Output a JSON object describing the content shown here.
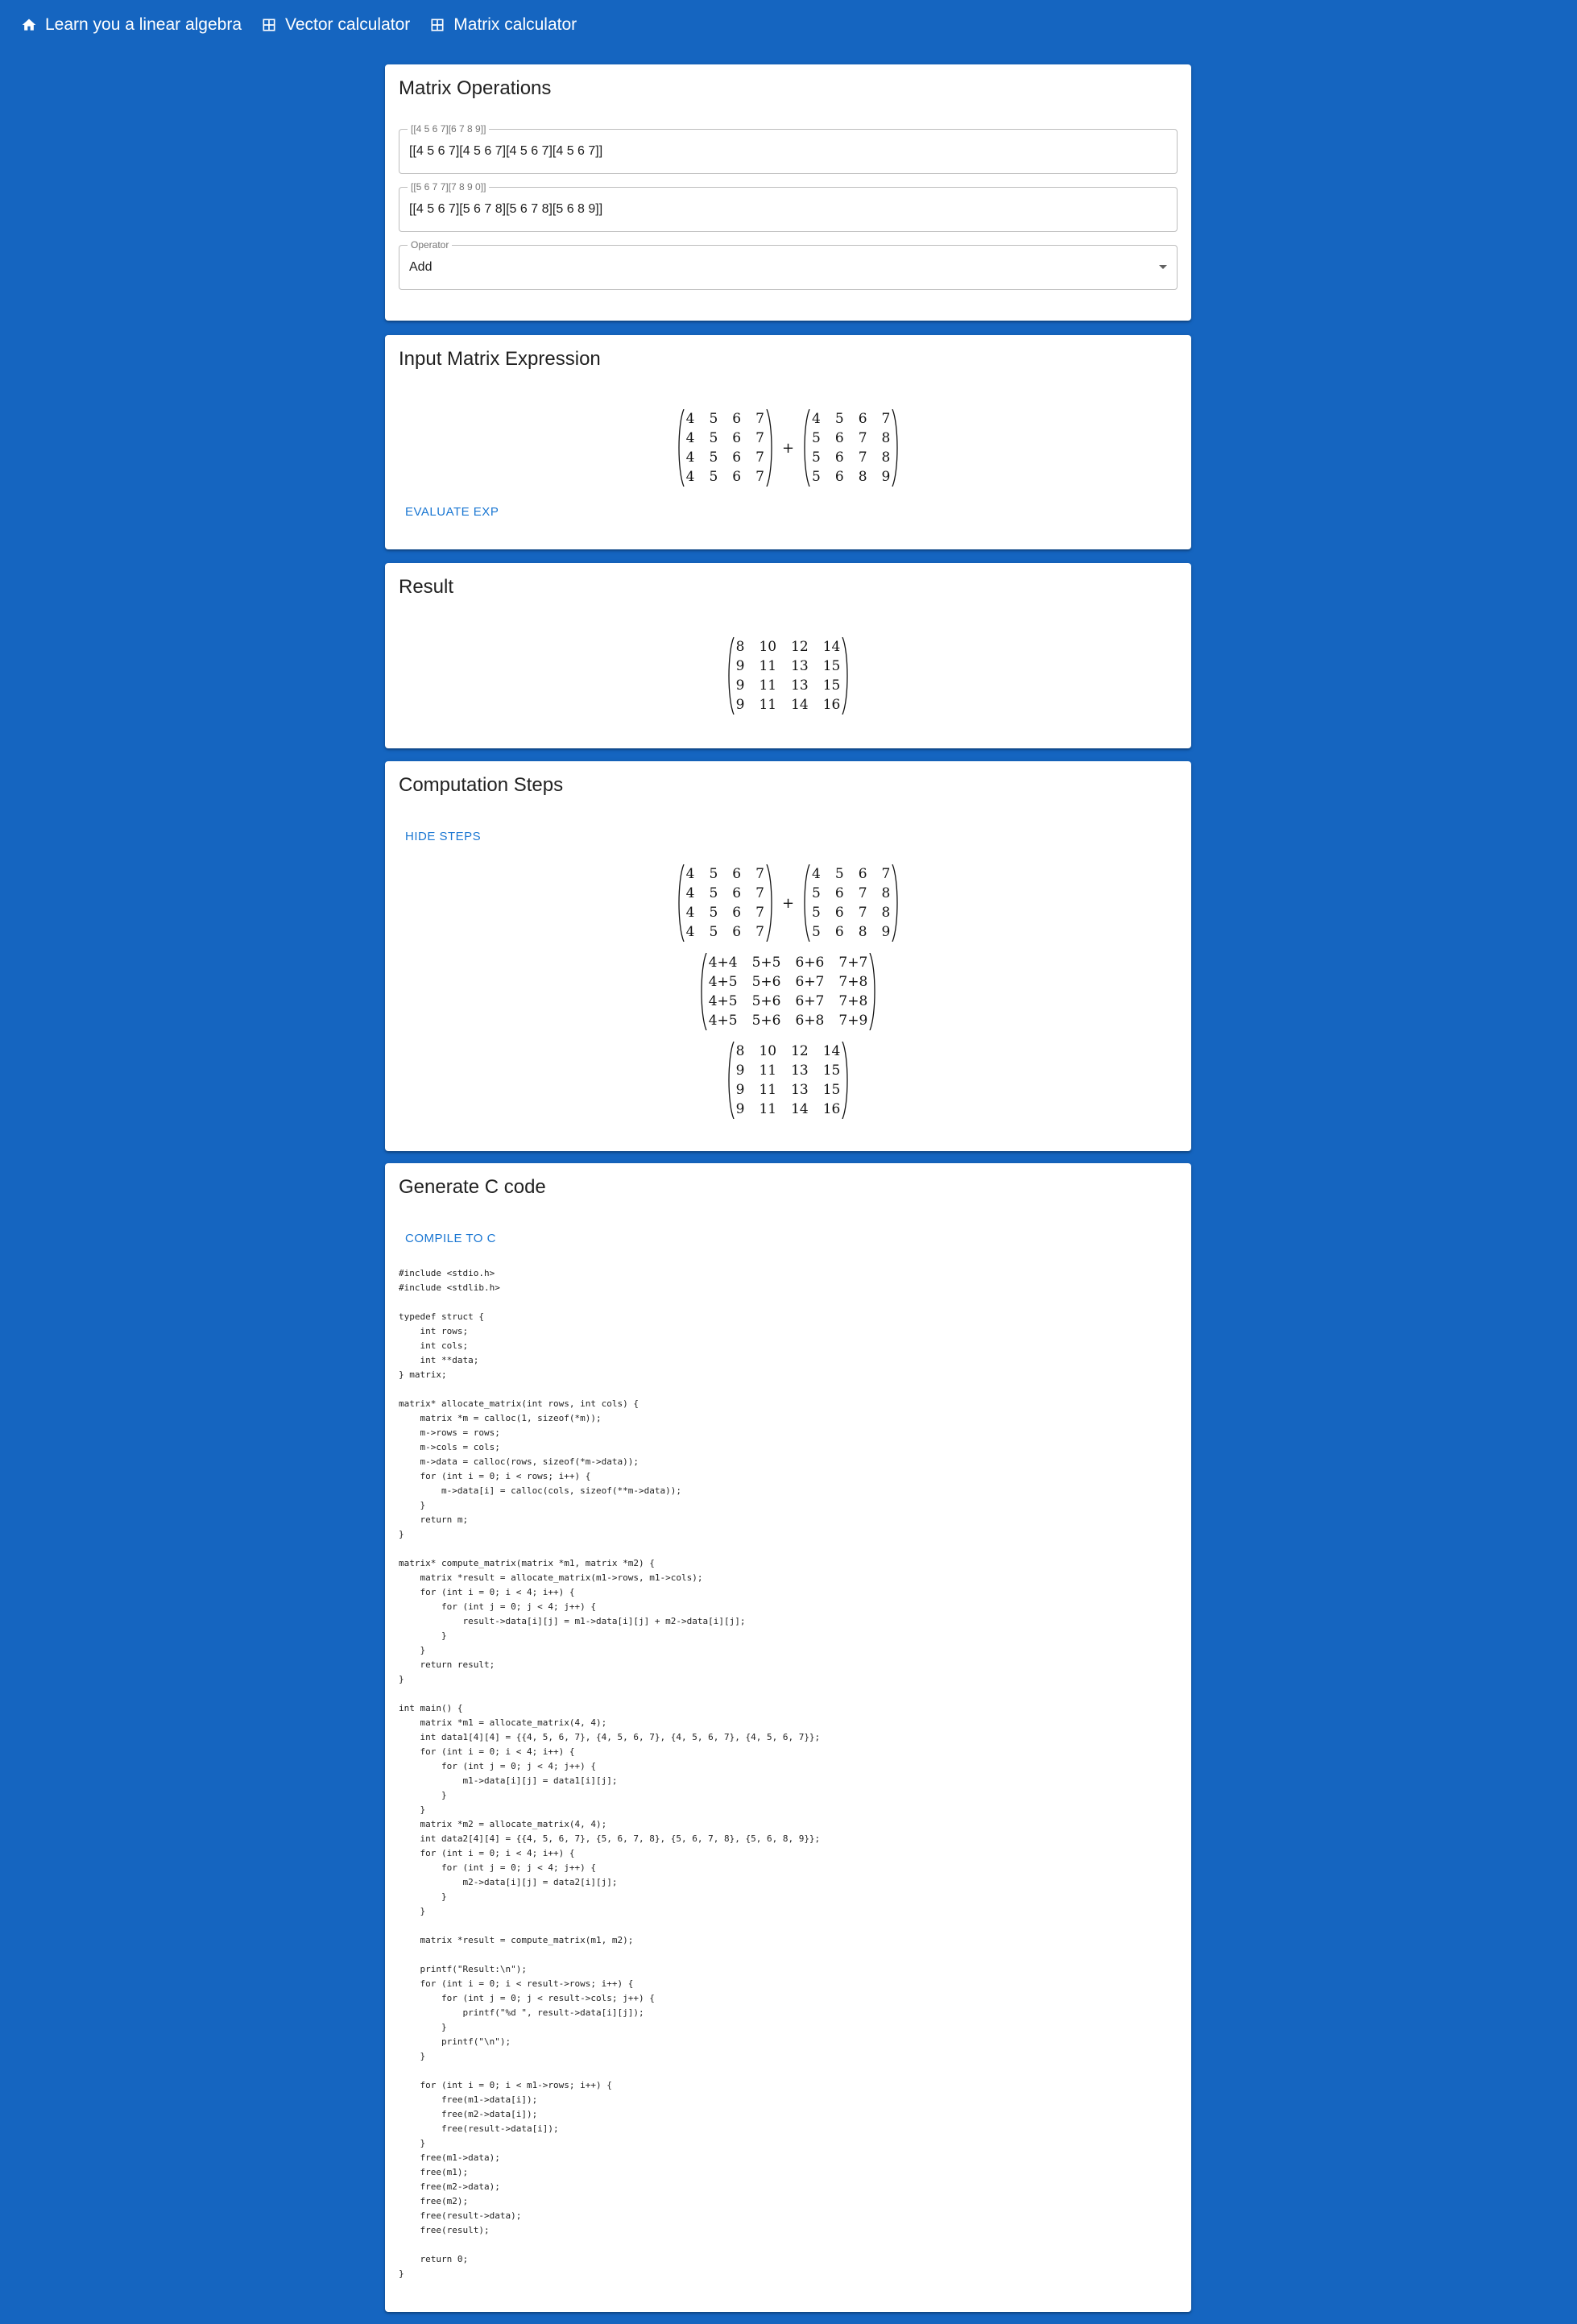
{
  "nav": {
    "home_label": "Learn you a linear algebra",
    "vector_label": "Vector calculator",
    "matrix_label": "Matrix calculator"
  },
  "operations": {
    "title": "Matrix Operations",
    "matrix1_label": "[[4 5 6 7][6 7 8 9]]",
    "matrix1_value": "[[4 5 6 7][4 5 6 7][4 5 6 7][4 5 6 7]]",
    "matrix2_label": "[[5 6 7 7][7 8 9 0]]",
    "matrix2_value": "[[4 5 6 7][5 6 7 8][5 6 7 8][5 6 8 9]]",
    "operator_label": "Operator",
    "operator_value": "Add"
  },
  "expression": {
    "title": "Input Matrix Expression",
    "operator_symbol": "+",
    "evaluate_label": "EVALUATE EXP",
    "m1": [
      [
        "4",
        "5",
        "6",
        "7"
      ],
      [
        "4",
        "5",
        "6",
        "7"
      ],
      [
        "4",
        "5",
        "6",
        "7"
      ],
      [
        "4",
        "5",
        "6",
        "7"
      ]
    ],
    "m2": [
      [
        "4",
        "5",
        "6",
        "7"
      ],
      [
        "5",
        "6",
        "7",
        "8"
      ],
      [
        "5",
        "6",
        "7",
        "8"
      ],
      [
        "5",
        "6",
        "8",
        "9"
      ]
    ]
  },
  "result": {
    "title": "Result",
    "matrix": [
      [
        "8",
        "10",
        "12",
        "14"
      ],
      [
        "9",
        "11",
        "13",
        "15"
      ],
      [
        "9",
        "11",
        "13",
        "15"
      ],
      [
        "9",
        "11",
        "14",
        "16"
      ]
    ]
  },
  "steps": {
    "title": "Computation Steps",
    "hide_label": "HIDE STEPS",
    "operator_symbol": "+",
    "m1": [
      [
        "4",
        "5",
        "6",
        "7"
      ],
      [
        "4",
        "5",
        "6",
        "7"
      ],
      [
        "4",
        "5",
        "6",
        "7"
      ],
      [
        "4",
        "5",
        "6",
        "7"
      ]
    ],
    "m2": [
      [
        "4",
        "5",
        "6",
        "7"
      ],
      [
        "5",
        "6",
        "7",
        "8"
      ],
      [
        "5",
        "6",
        "7",
        "8"
      ],
      [
        "5",
        "6",
        "8",
        "9"
      ]
    ],
    "sum_matrix": [
      [
        "4+4",
        "5+5",
        "6+6",
        "7+7"
      ],
      [
        "4+5",
        "5+6",
        "6+7",
        "7+8"
      ],
      [
        "4+5",
        "5+6",
        "6+7",
        "7+8"
      ],
      [
        "4+5",
        "5+6",
        "6+8",
        "7+9"
      ]
    ],
    "result_matrix": [
      [
        "8",
        "10",
        "12",
        "14"
      ],
      [
        "9",
        "11",
        "13",
        "15"
      ],
      [
        "9",
        "11",
        "13",
        "15"
      ],
      [
        "9",
        "11",
        "14",
        "16"
      ]
    ]
  },
  "codegen": {
    "title": "Generate C code",
    "compile_label": "COMPILE TO C",
    "code": "#include <stdio.h>\n#include <stdlib.h>\n\ntypedef struct {\n    int rows;\n    int cols;\n    int **data;\n} matrix;\n\nmatrix* allocate_matrix(int rows, int cols) {\n    matrix *m = calloc(1, sizeof(*m));\n    m->rows = rows;\n    m->cols = cols;\n    m->data = calloc(rows, sizeof(*m->data));\n    for (int i = 0; i < rows; i++) {\n        m->data[i] = calloc(cols, sizeof(**m->data));\n    }\n    return m;\n}\n\nmatrix* compute_matrix(matrix *m1, matrix *m2) {\n    matrix *result = allocate_matrix(m1->rows, m1->cols);\n    for (int i = 0; i < 4; i++) {\n        for (int j = 0; j < 4; j++) {\n            result->data[i][j] = m1->data[i][j] + m2->data[i][j];\n        }\n    }\n    return result;\n}\n\nint main() {\n    matrix *m1 = allocate_matrix(4, 4);\n    int data1[4][4] = {{4, 5, 6, 7}, {4, 5, 6, 7}, {4, 5, 6, 7}, {4, 5, 6, 7}};\n    for (int i = 0; i < 4; i++) {\n        for (int j = 0; j < 4; j++) {\n            m1->data[i][j] = data1[i][j];\n        }\n    }\n    matrix *m2 = allocate_matrix(4, 4);\n    int data2[4][4] = {{4, 5, 6, 7}, {5, 6, 7, 8}, {5, 6, 7, 8}, {5, 6, 8, 9}};\n    for (int i = 0; i < 4; i++) {\n        for (int j = 0; j < 4; j++) {\n            m2->data[i][j] = data2[i][j];\n        }\n    }\n\n    matrix *result = compute_matrix(m1, m2);\n\n    printf(\"Result:\\n\");\n    for (int i = 0; i < result->rows; i++) {\n        for (int j = 0; j < result->cols; j++) {\n            printf(\"%d \", result->data[i][j]);\n        }\n        printf(\"\\n\");\n    }\n\n    for (int i = 0; i < m1->rows; i++) {\n        free(m1->data[i]);\n        free(m2->data[i]);\n        free(result->data[i]);\n    }\n    free(m1->data);\n    free(m1);\n    free(m2->data);\n    free(m2);\n    free(result->data);\n    free(result);\n\n    return 0;\n}"
  }
}
